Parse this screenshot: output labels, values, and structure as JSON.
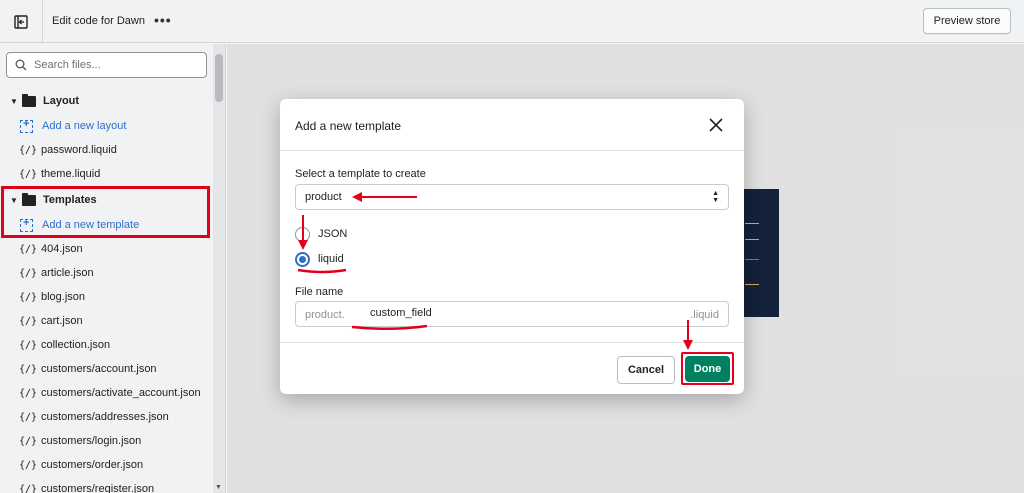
{
  "topbar": {
    "title": "Edit code for Dawn",
    "more_label": "•••",
    "preview_label": "Preview store"
  },
  "sidebar": {
    "search_placeholder": "Search files...",
    "layout_folder": "Layout",
    "layout_add": "Add a new layout",
    "layout_files": [
      "password.liquid",
      "theme.liquid"
    ],
    "templates_folder": "Templates",
    "templates_add": "Add a new template",
    "template_files": [
      "404.json",
      "article.json",
      "blog.json",
      "cart.json",
      "collection.json",
      "customers/account.json",
      "customers/activate_account.json",
      "customers/addresses.json",
      "customers/login.json",
      "customers/order.json",
      "customers/register.json"
    ],
    "file_icon": "{/}"
  },
  "modal": {
    "title": "Add a new template",
    "select_label": "Select a template to create",
    "select_value": "product",
    "radio_json": "JSON",
    "radio_liquid": "liquid",
    "file_name_label": "File name",
    "prefix": "product.",
    "file_name_value": "custom_field",
    "suffix": ".liquid",
    "cancel_label": "Cancel",
    "done_label": "Done"
  },
  "colors": {
    "accent": "#2c6ecb",
    "primary_button": "#008060",
    "annotation": "#e3001b"
  }
}
